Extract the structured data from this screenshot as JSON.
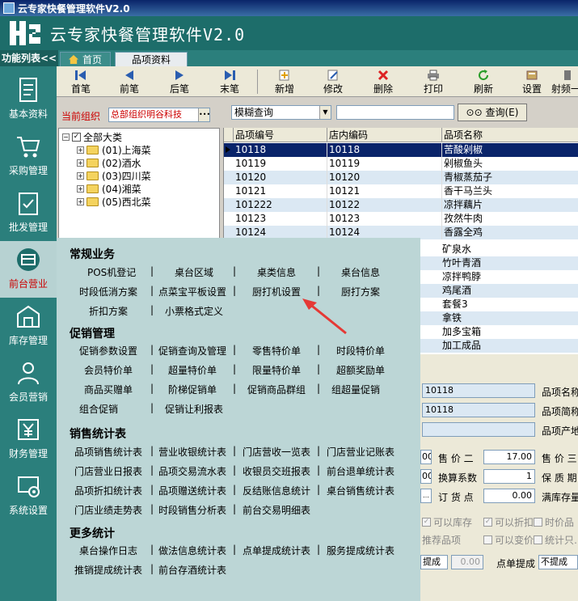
{
  "window": {
    "title": "云专家快餐管理软件V2.0"
  },
  "brand": {
    "title": "云专家快餐管理软件V2.0"
  },
  "funcbar": {
    "label": "功能列表<<",
    "tabs": [
      "首页",
      "品项资料"
    ]
  },
  "sidebar": {
    "items": [
      "基本资料",
      "采购管理",
      "批发管理",
      "前台营业",
      "库存管理",
      "会员营销",
      "财务管理",
      "系统设置"
    ]
  },
  "toolbar": {
    "buttons": [
      "首笔",
      "前笔",
      "后笔",
      "末笔",
      "新增",
      "修改",
      "删除",
      "打印",
      "刷新",
      "设置",
      "射频一"
    ]
  },
  "org": {
    "label": "当前组织",
    "value": "总部组织明谷科技"
  },
  "tree": {
    "root": "全部大类",
    "items": [
      "(01)上海菜",
      "(02)酒水",
      "(03)四川菜",
      "(04)湘菜",
      "(05)西北菜"
    ]
  },
  "search": {
    "mode": "模糊查询",
    "button": "查询(E)"
  },
  "grid": {
    "columns": [
      "品项编号",
      "店内编码",
      "品项名称"
    ],
    "rows": [
      [
        "10118",
        "10118",
        "苦酸剁椒"
      ],
      [
        "10119",
        "10119",
        "剁椒鱼头"
      ],
      [
        "10120",
        "10120",
        "青椒蒸茄子"
      ],
      [
        "10121",
        "10121",
        "香干马兰头"
      ],
      [
        "101222",
        "10122",
        "凉拌藕片"
      ],
      [
        "10123",
        "10123",
        "孜然牛肉"
      ],
      [
        "10124",
        "10124",
        "香露全鸡"
      ]
    ]
  },
  "lower_names": [
    "矿泉水",
    "竹叶青酒",
    "凉拌鸭脖",
    "鸡尾酒",
    "套餐3",
    "拿铁",
    "加多宝箱",
    "加工成品"
  ],
  "form": {
    "code": "10118",
    "inner_code": "10118",
    "labels": {
      "name": "品项名称",
      "abbr": "品项简称",
      "origin": "品项产地",
      "price2": "售 价 二",
      "price3": "售 价 三",
      "conv": "换算系数",
      "shelf": "保 质 期",
      "order_point": "订 货 点",
      "full_stock": "满库存量",
      "point_commission": "点单提成"
    },
    "price2": "17.00",
    "conv": "1",
    "order_point": "0.00",
    "left_prefix_1": "00",
    "left_prefix_2": "00",
    "checks": [
      "可以库存",
      "可以折扣",
      "时价品",
      "推荐品项",
      "可以变价",
      "统计只…"
    ],
    "commission_mode": "提成",
    "commission_value": "0.00",
    "commission_select": "不提成"
  },
  "menu": {
    "sections": [
      {
        "title": "常规业务",
        "rows": [
          [
            "POS机登记",
            "桌台区域",
            "桌类信息",
            "桌台信息"
          ],
          [
            "时段低消方案",
            "点菜宝平板设置",
            "厨打机设置",
            "厨打方案"
          ],
          [
            "折扣方案",
            "小票格式定义"
          ]
        ]
      },
      {
        "title": "促销管理",
        "rows": [
          [
            "促销参数设置",
            "促销查询及管理",
            "零售特价单",
            "时段特价单"
          ],
          [
            "会员特价单",
            "超量特价单",
            "限量特价单",
            "超额奖励单"
          ],
          [
            "商品买赠单",
            "阶梯促销单",
            "促销商品群组",
            "组超量促销"
          ],
          [
            "组合促销",
            "促销让利报表"
          ]
        ]
      },
      {
        "title": "销售统计表",
        "rows": [
          [
            "品项销售统计表",
            "营业收银统计表",
            "门店营收一览表",
            "门店营业记账表"
          ],
          [
            "门店营业日报表",
            "品项交易流水表",
            "收银员交班报表",
            "前台退单统计表"
          ],
          [
            "品项折扣统计表",
            "品项赠送统计表",
            "反结账信息统计",
            "桌台销售统计表"
          ],
          [
            "门店业绩走势表",
            "时段销售分析表",
            "前台交易明细表"
          ]
        ]
      },
      {
        "title": "更多统计",
        "rows": [
          [
            "桌台操作日志",
            "做法信息统计表",
            "点单提成统计表",
            "服务提成统计表"
          ],
          [
            "推销提成统计表",
            "前台存酒统计表"
          ]
        ]
      }
    ]
  },
  "colors": {
    "sidebar": "#2b7f7c",
    "menu": "#bcd6d6",
    "selected_row": "#0a246a",
    "arrow": "#e53935"
  }
}
